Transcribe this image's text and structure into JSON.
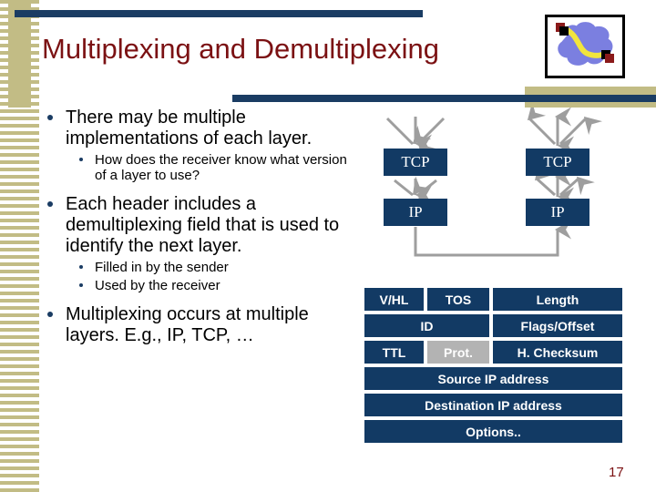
{
  "slide": {
    "title": "Multiplexing and Demultiplexing",
    "page_number": "17",
    "colors": {
      "title_red": "#7b1113",
      "bar_navy": "#1a3c63",
      "box_navy": "#123a64",
      "tan": "#c2bc85",
      "highlight_gray": "#b3b3b3",
      "arrow_gray": "#9e9e9e"
    }
  },
  "logo": {
    "name": "network-cloud-logo",
    "cloud_color": "#7b7fe0",
    "link_color": "#f2e53c",
    "node_color": "#8b1a1a"
  },
  "bullets": [
    {
      "level": 1,
      "text": "There may be multiple implementations of each layer."
    },
    {
      "level": 2,
      "text": "How does the receiver know what version of a layer to use?"
    },
    {
      "level": 1,
      "text": "Each header includes a demultiplexing field that is used to identify the next layer."
    },
    {
      "level": 2,
      "text": "Filled in by the sender"
    },
    {
      "level": 2,
      "text": "Used by the receiver"
    },
    {
      "level": 1,
      "text": "Multiplexing occurs at multiple layers.  E.g., IP, TCP, …"
    }
  ],
  "diagram": {
    "name": "protocol-stack-mux-demux",
    "left_stack": {
      "top_label": "TCP",
      "bottom_label": "IP",
      "direction": "converging-down"
    },
    "right_stack": {
      "top_label": "TCP",
      "bottom_label": "IP",
      "direction": "diverging-up"
    }
  },
  "ip_header": {
    "name": "ip-header-diagram",
    "rows": [
      {
        "cells": [
          {
            "label": "V/HL",
            "highlighted": false
          },
          {
            "label": "TOS",
            "highlighted": false
          },
          {
            "label": "Length",
            "highlighted": false
          }
        ]
      },
      {
        "cells": [
          {
            "label": "ID",
            "highlighted": false
          },
          {
            "label": "Flags/Offset",
            "highlighted": false
          }
        ]
      },
      {
        "cells": [
          {
            "label": "TTL",
            "highlighted": false
          },
          {
            "label": "Prot.",
            "highlighted": true
          },
          {
            "label": "H. Checksum",
            "highlighted": false
          }
        ]
      },
      {
        "cells": [
          {
            "label": "Source IP address",
            "highlighted": false
          }
        ]
      },
      {
        "cells": [
          {
            "label": "Destination IP address",
            "highlighted": false
          }
        ]
      },
      {
        "cells": [
          {
            "label": "Options..",
            "highlighted": false
          }
        ]
      }
    ]
  }
}
